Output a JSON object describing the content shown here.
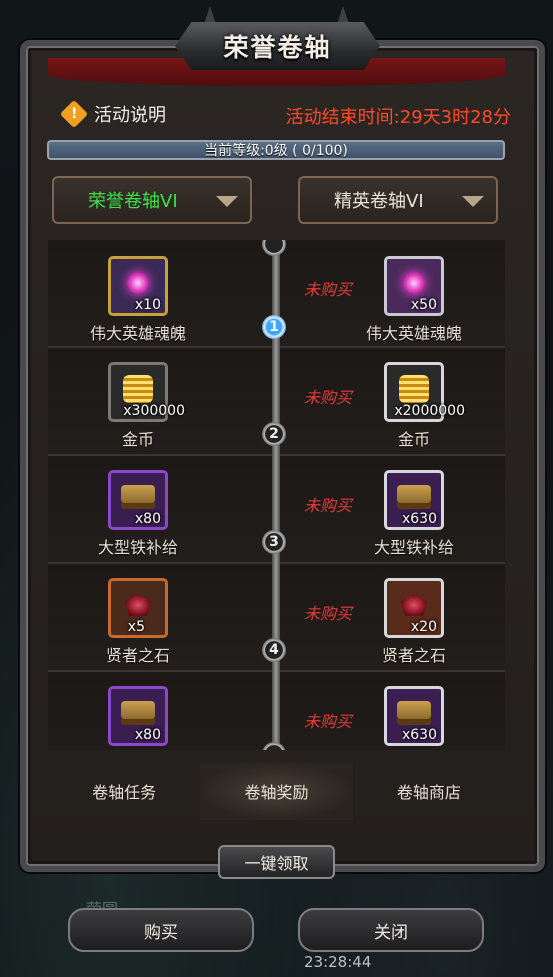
{
  "title": "荣誉卷轴",
  "info": {
    "label": "活动说明",
    "icon": "warning-icon",
    "end_time": "活动结束时间:29天3时28分"
  },
  "progress": {
    "text": "当前等级:0级 ( 0/100)",
    "current": 0,
    "max": 100
  },
  "dropdowns": {
    "left": "荣誉卷轴VI",
    "right": "精英卷轴VI"
  },
  "rows": [
    {
      "level": "1",
      "left": {
        "qty": "x10",
        "name": "伟大英雄魂魄"
      },
      "status": "未购买",
      "right": {
        "qty": "x50",
        "name": "伟大英雄魂魄"
      }
    },
    {
      "level": "2",
      "left": {
        "qty": "x300000",
        "name": "金币"
      },
      "status": "未购买",
      "right": {
        "qty": "x2000000",
        "name": "金币"
      }
    },
    {
      "level": "3",
      "left": {
        "qty": "x80",
        "name": "大型铁补给"
      },
      "status": "未购买",
      "right": {
        "qty": "x630",
        "name": "大型铁补给"
      }
    },
    {
      "level": "4",
      "left": {
        "qty": "x5",
        "name": "贤者之石"
      },
      "status": "未购买",
      "right": {
        "qty": "x20",
        "name": "贤者之石"
      }
    },
    {
      "left": {
        "qty": "x80"
      },
      "status": "未购买",
      "right": {
        "qty": "x630"
      }
    }
  ],
  "tabs": [
    "卷轴任务",
    "卷轴奖励",
    "卷轴商店"
  ],
  "claim_all": "一键领取",
  "buttons": {
    "buy": "购买",
    "close": "关闭"
  },
  "clock": "23:28:44",
  "colors": {
    "accent_red": "#ff4a2a",
    "active_green": "#3ee04a",
    "unbought": "#e23b3b"
  }
}
